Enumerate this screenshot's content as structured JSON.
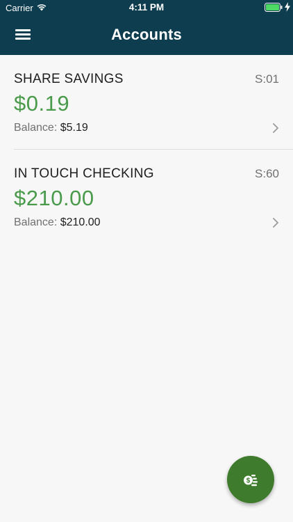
{
  "status_bar": {
    "carrier": "Carrier",
    "time": "4:11 PM",
    "icons": [
      "wifi-icon",
      "battery-icon",
      "charging-bolt-icon"
    ]
  },
  "header": {
    "title": "Accounts",
    "menu_icon": "hamburger-menu-icon",
    "background_color": "#0d3d4f"
  },
  "accounts": [
    {
      "name": "SHARE SAVINGS",
      "suffix": "S:01",
      "available": "$0.19",
      "balance_label": "Balance:",
      "balance": "$5.19"
    },
    {
      "name": "IN TOUCH CHECKING",
      "suffix": "S:60",
      "available": "$210.00",
      "balance_label": "Balance:",
      "balance": "$210.00"
    }
  ],
  "fab": {
    "icon": "transfer-money-icon",
    "color": "#3e7b2c"
  },
  "colors": {
    "amount_green": "#4a9a4c",
    "page_background": "#f7f7f7"
  }
}
